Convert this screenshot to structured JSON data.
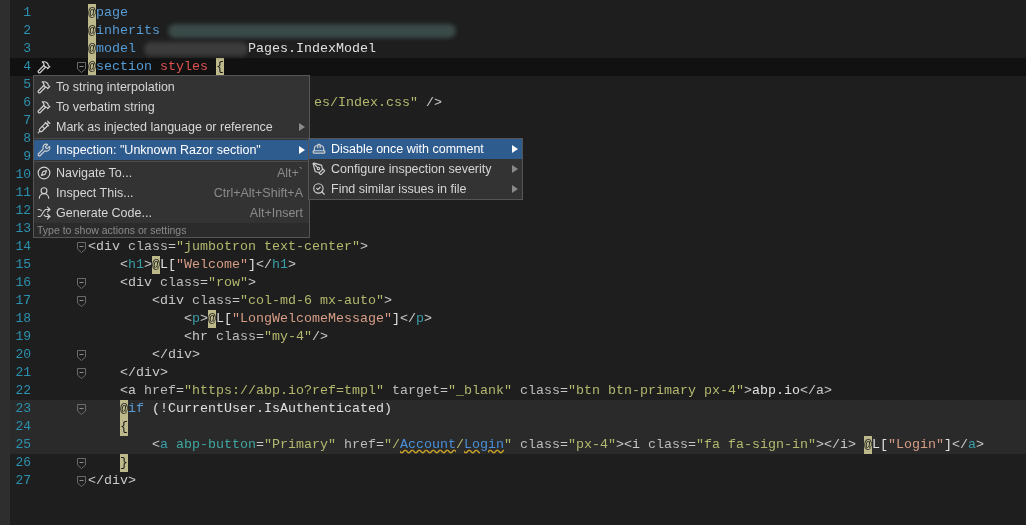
{
  "editor": {
    "lines": [
      {
        "number": "1",
        "kind": "plain",
        "current": false,
        "scope": false,
        "fold": false,
        "tokens": [
          {
            "text": "@",
            "kind": "at"
          },
          {
            "text": "page",
            "kind": "kw"
          }
        ]
      },
      {
        "number": "2",
        "kind": "plain",
        "current": false,
        "scope": false,
        "fold": false,
        "tokens": [
          {
            "text": "@",
            "kind": "at"
          },
          {
            "text": "inherits ",
            "kind": "kw"
          },
          {
            "kind": "smudge"
          }
        ]
      },
      {
        "number": "3",
        "kind": "plain",
        "current": false,
        "scope": false,
        "fold": false,
        "tokens": [
          {
            "text": "@",
            "kind": "at"
          },
          {
            "text": "model ",
            "kind": "kw"
          },
          {
            "kind": "blur"
          },
          {
            "text": "Pages.IndexModel",
            "kind": "text"
          }
        ]
      },
      {
        "number": "4",
        "kind": "plain",
        "current": true,
        "scope": false,
        "fold": true,
        "tokens": [
          {
            "text": "@",
            "kind": "at"
          },
          {
            "text": "section ",
            "kind": "kw"
          },
          {
            "text": "styles ",
            "kind": "red"
          },
          {
            "text": "{",
            "kind": "at"
          }
        ]
      },
      {
        "number": "5",
        "current": false,
        "scope": false,
        "fold": false
      },
      {
        "number": "6",
        "kind": "partial",
        "current": false,
        "scope": false,
        "fold": false,
        "tokens": [
          {
            "text": "es/Index.css\"",
            "kind": "str"
          },
          {
            "text": " />",
            "kind": "tag"
          }
        ]
      },
      {
        "number": "7",
        "current": false,
        "scope": false,
        "fold": false
      },
      {
        "number": "8",
        "current": false,
        "scope": false,
        "fold": false
      },
      {
        "number": "9",
        "current": false,
        "scope": false,
        "fold": false
      },
      {
        "number": "10",
        "current": false,
        "scope": false,
        "fold": false
      },
      {
        "number": "11",
        "current": false,
        "scope": false,
        "fold": false
      },
      {
        "number": "12",
        "current": false,
        "scope": false,
        "fold": false
      },
      {
        "number": "13",
        "current": false,
        "scope": false,
        "fold": false
      },
      {
        "number": "14",
        "kind": "plain",
        "current": false,
        "scope": false,
        "fold": true,
        "tokens": [
          {
            "text": "<div",
            "kind": "tag"
          },
          {
            "text": " class",
            "kind": "attr"
          },
          {
            "text": "=",
            "kind": "tag"
          },
          {
            "text": "\"jumbotron text-center\"",
            "kind": "str"
          },
          {
            "text": ">",
            "kind": "tag"
          }
        ]
      },
      {
        "number": "15",
        "kind": "plain",
        "current": false,
        "scope": false,
        "fold": false,
        "tokens": [
          {
            "text": "    <",
            "kind": "tag"
          },
          {
            "text": "h1",
            "kind": "tn"
          },
          {
            "text": ">",
            "kind": "tag"
          },
          {
            "text": "@",
            "kind": "at"
          },
          {
            "text": "L[",
            "kind": "text"
          },
          {
            "text": "\"Welcome\"",
            "kind": "res"
          },
          {
            "text": "]",
            "kind": "text"
          },
          {
            "text": "</",
            "kind": "tag"
          },
          {
            "text": "h1",
            "kind": "tn"
          },
          {
            "text": ">",
            "kind": "tag"
          }
        ]
      },
      {
        "number": "16",
        "kind": "plain",
        "current": false,
        "scope": false,
        "fold": true,
        "tokens": [
          {
            "text": "    <div",
            "kind": "tag"
          },
          {
            "text": " class",
            "kind": "attr"
          },
          {
            "text": "=",
            "kind": "tag"
          },
          {
            "text": "\"row\"",
            "kind": "str"
          },
          {
            "text": ">",
            "kind": "tag"
          }
        ]
      },
      {
        "number": "17",
        "kind": "plain",
        "current": false,
        "scope": false,
        "fold": true,
        "tokens": [
          {
            "text": "        <div",
            "kind": "tag"
          },
          {
            "text": " class",
            "kind": "attr"
          },
          {
            "text": "=",
            "kind": "tag"
          },
          {
            "text": "\"col-md-6 mx-auto\"",
            "kind": "str"
          },
          {
            "text": ">",
            "kind": "tag"
          }
        ]
      },
      {
        "number": "18",
        "kind": "plain",
        "current": false,
        "scope": false,
        "fold": false,
        "tokens": [
          {
            "text": "            <",
            "kind": "tag"
          },
          {
            "text": "p",
            "kind": "tn"
          },
          {
            "text": ">",
            "kind": "tag"
          },
          {
            "text": "@",
            "kind": "at"
          },
          {
            "text": "L[",
            "kind": "text"
          },
          {
            "text": "\"LongWelcomeMessage\"",
            "kind": "res"
          },
          {
            "text": "]",
            "kind": "text"
          },
          {
            "text": "</",
            "kind": "tag"
          },
          {
            "text": "p",
            "kind": "tn"
          },
          {
            "text": ">",
            "kind": "tag"
          }
        ]
      },
      {
        "number": "19",
        "kind": "plain",
        "current": false,
        "scope": false,
        "fold": false,
        "tokens": [
          {
            "text": "            <hr",
            "kind": "tag"
          },
          {
            "text": " class",
            "kind": "attr"
          },
          {
            "text": "=",
            "kind": "tag"
          },
          {
            "text": "\"my-4\"",
            "kind": "str"
          },
          {
            "text": "/>",
            "kind": "tag"
          }
        ]
      },
      {
        "number": "20",
        "kind": "plain",
        "current": false,
        "scope": false,
        "fold": true,
        "tokens": [
          {
            "text": "        </div>",
            "kind": "tag"
          }
        ]
      },
      {
        "number": "21",
        "kind": "plain",
        "current": false,
        "scope": false,
        "fold": true,
        "tokens": [
          {
            "text": "    </div>",
            "kind": "tag"
          }
        ]
      },
      {
        "number": "22",
        "kind": "plain",
        "current": false,
        "scope": false,
        "fold": false,
        "tokens": [
          {
            "text": "    <a",
            "kind": "tag"
          },
          {
            "text": " href",
            "kind": "attr"
          },
          {
            "text": "=",
            "kind": "tag"
          },
          {
            "text": "\"https://abp.io?ref=tmpl\"",
            "kind": "str"
          },
          {
            "text": " target",
            "kind": "attr"
          },
          {
            "text": "=",
            "kind": "tag"
          },
          {
            "text": "\"_blank\"",
            "kind": "str"
          },
          {
            "text": " class",
            "kind": "attr"
          },
          {
            "text": "=",
            "kind": "tag"
          },
          {
            "text": "\"btn btn-primary px-4\"",
            "kind": "str"
          },
          {
            "text": ">",
            "kind": "tag"
          },
          {
            "text": "abp.io",
            "kind": "text"
          },
          {
            "text": "</a>",
            "kind": "tag"
          }
        ]
      },
      {
        "number": "23",
        "kind": "indented",
        "current": false,
        "scope": true,
        "fold": true,
        "tokens": [
          {
            "text": "@",
            "kind": "at"
          },
          {
            "text": "if",
            "kind": "kw"
          },
          {
            "text": " (!CurrentUser.IsAuthenticated)",
            "kind": "text"
          }
        ]
      },
      {
        "number": "24",
        "kind": "indented",
        "current": false,
        "scope": true,
        "fold": false,
        "tokens": [
          {
            "text": "{",
            "kind": "at"
          }
        ]
      },
      {
        "number": "25",
        "kind": "plain",
        "current": false,
        "scope": true,
        "fold": false,
        "tokens": [
          {
            "text": "        <",
            "kind": "tag"
          },
          {
            "text": "a",
            "kind": "tn"
          },
          {
            "text": " abp-button",
            "kind": "ta"
          },
          {
            "text": "=",
            "kind": "tag"
          },
          {
            "text": "\"Primary\"",
            "kind": "str"
          },
          {
            "text": " href",
            "kind": "attr"
          },
          {
            "text": "=",
            "kind": "tag"
          },
          {
            "text": "\"/",
            "kind": "str"
          },
          {
            "text": "Account",
            "kind": "link"
          },
          {
            "text": "/",
            "kind": "str"
          },
          {
            "text": "Login",
            "kind": "link"
          },
          {
            "text": "\"",
            "kind": "str"
          },
          {
            "text": " class",
            "kind": "attr"
          },
          {
            "text": "=",
            "kind": "tag"
          },
          {
            "text": "\"px-4\"",
            "kind": "str"
          },
          {
            "text": "><i",
            "kind": "tag"
          },
          {
            "text": " class",
            "kind": "attr"
          },
          {
            "text": "=",
            "kind": "tag"
          },
          {
            "text": "\"fa fa-sign-in\"",
            "kind": "str"
          },
          {
            "text": "></i> ",
            "kind": "tag"
          },
          {
            "text": "@",
            "kind": "at"
          },
          {
            "text": "L[",
            "kind": "text"
          },
          {
            "text": "\"Login\"",
            "kind": "res"
          },
          {
            "text": "]",
            "kind": "text"
          },
          {
            "text": "</",
            "kind": "tag"
          },
          {
            "text": "a",
            "kind": "tn"
          },
          {
            "text": ">",
            "kind": "tag"
          }
        ]
      },
      {
        "number": "26",
        "kind": "indented",
        "current": false,
        "scope": false,
        "fold": true,
        "tokens": [
          {
            "text": "}",
            "kind": "at"
          }
        ]
      },
      {
        "number": "27",
        "kind": "plain",
        "current": false,
        "scope": false,
        "fold": true,
        "tokens": [
          {
            "text": "</div>",
            "kind": "tag"
          }
        ]
      }
    ]
  },
  "menu": {
    "groups": [
      [
        {
          "label": "To string interpolation",
          "submenu": false,
          "selected": false
        },
        {
          "label": "To verbatim string",
          "submenu": false,
          "selected": false
        },
        {
          "label": "Mark as injected language or reference",
          "submenu": true,
          "selected": false
        }
      ],
      [
        {
          "label": "Inspection: \"Unknown Razor section\"",
          "submenu": true,
          "selected": true
        }
      ],
      [
        {
          "label": "Navigate To...",
          "shortcut": "Alt+`",
          "submenu": false,
          "selected": false
        },
        {
          "label": "Inspect This...",
          "shortcut": "Ctrl+Alt+Shift+A",
          "submenu": false,
          "selected": false
        },
        {
          "label": "Generate Code...",
          "shortcut": "Alt+Insert",
          "submenu": false,
          "selected": false
        }
      ]
    ],
    "hint": "Type to show actions or settings"
  },
  "submenu": {
    "items": [
      {
        "label": "Disable once with comment",
        "submenu": true,
        "selected": true
      },
      {
        "label": "Configure inspection severity",
        "submenu": true,
        "selected": false
      },
      {
        "label": "Find similar issues in file",
        "submenu": true,
        "selected": false
      }
    ]
  }
}
